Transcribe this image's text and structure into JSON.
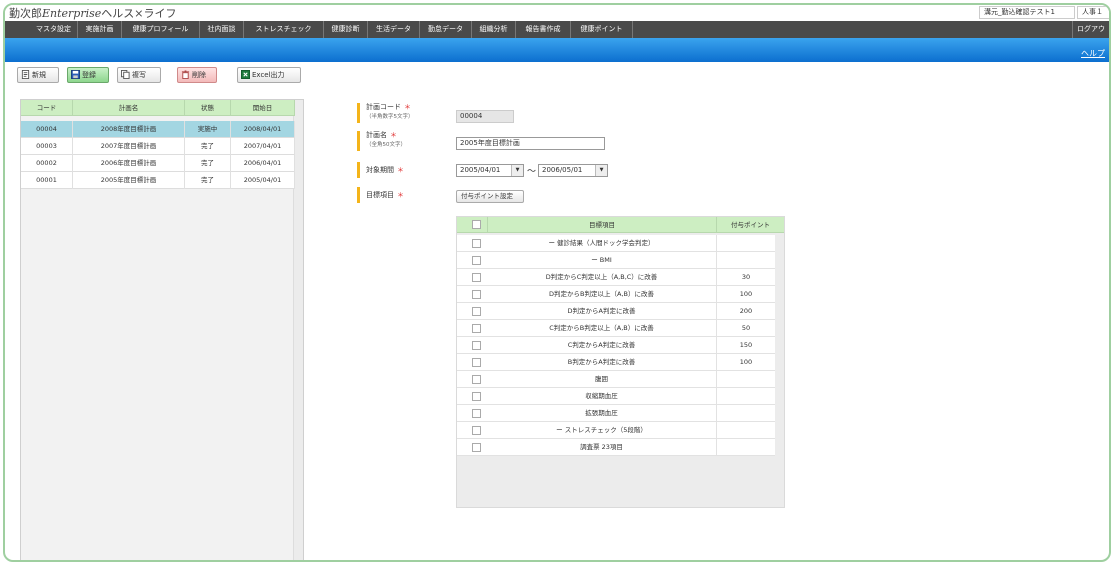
{
  "app": {
    "logo_prefix": "勤次郎",
    "logo_enterprise": "Enterprise",
    "logo_suffix": "ヘルス×ライフ",
    "user_name": "溝元_勤込確認テスト1",
    "user_role": "人事１"
  },
  "nav": {
    "items": [
      "マスタ設定",
      "実施計画",
      "健康プロフィール",
      "社内面談",
      "ストレスチェック",
      "健康診断",
      "生活データ",
      "勤怠データ",
      "組織分析",
      "報告書作成",
      "健康ポイント"
    ],
    "logout": "ログアウ"
  },
  "help_label": "ヘルプ",
  "toolbar": {
    "new_label": "新規",
    "register_label": "登録",
    "copy_label": "複写",
    "delete_label": "削除",
    "excel_label": "Excel出力"
  },
  "plan_list": {
    "headers": [
      "コード",
      "計画名",
      "状態",
      "開始日"
    ],
    "rows": [
      {
        "code": "00004",
        "name": "2008年度目標計画",
        "status": "実施中",
        "start": "2008/04/01"
      },
      {
        "code": "00003",
        "name": "2007年度目標計画",
        "status": "完了",
        "start": "2007/04/01"
      },
      {
        "code": "00002",
        "name": "2006年度目標計画",
        "status": "完了",
        "start": "2006/04/01"
      },
      {
        "code": "00001",
        "name": "2005年度目標計画",
        "status": "完了",
        "start": "2005/04/01"
      }
    ]
  },
  "form": {
    "code_label": "計画コード",
    "code_sub": "（半角数字5文字）",
    "code_value": "00004",
    "name_label": "計画名",
    "name_sub": "（全角50文字）",
    "name_value": "2005年度目標計画",
    "period_label": "対象期間",
    "period_from": "2005/04/01",
    "period_to": "2006/05/01",
    "tilde": "〜",
    "items_label": "目標項目",
    "points_button": "付与ポイント設定",
    "required_mark": "＊"
  },
  "targets": {
    "headers": [
      "目標項目",
      "付与ポイント"
    ],
    "rows": [
      {
        "item": "ー 健診結果（人間ドック学会判定）",
        "points": ""
      },
      {
        "item": "ー BMI",
        "points": ""
      },
      {
        "item": "D判定からC判定以上（A,B,C）に改善",
        "points": "30"
      },
      {
        "item": "D判定からB判定以上（A,B）に改善",
        "points": "100"
      },
      {
        "item": "D判定からA判定に改善",
        "points": "200"
      },
      {
        "item": "C判定からB判定以上（A,B）に改善",
        "points": "50"
      },
      {
        "item": "C判定からA判定に改善",
        "points": "150"
      },
      {
        "item": "B判定からA判定に改善",
        "points": "100"
      },
      {
        "item": "腹囲",
        "points": ""
      },
      {
        "item": "収縮期血圧",
        "points": ""
      },
      {
        "item": "拡張期血圧",
        "points": ""
      },
      {
        "item": "ー ストレスチェック（5段階）",
        "points": ""
      },
      {
        "item": "調査票 23項目",
        "points": ""
      }
    ]
  }
}
